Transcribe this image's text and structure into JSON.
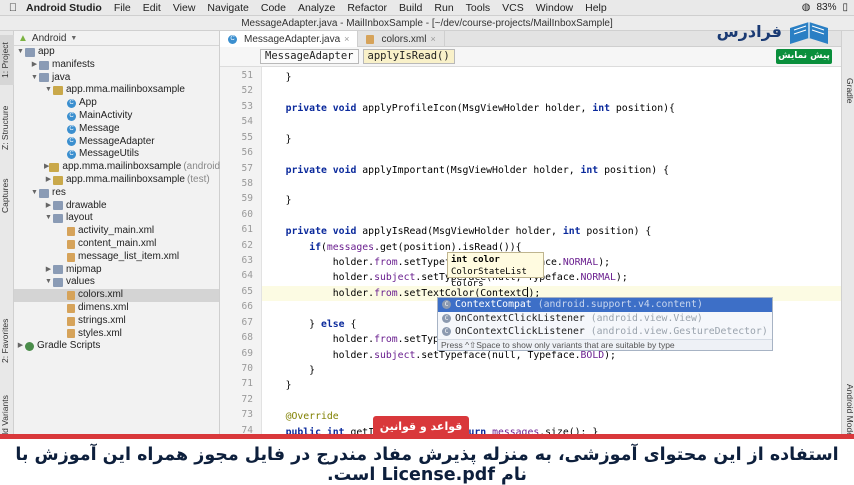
{
  "menubar": {
    "apple": "",
    "app_name": "Android Studio",
    "items": [
      "File",
      "Edit",
      "View",
      "Navigate",
      "Code",
      "Analyze",
      "Refactor",
      "Build",
      "Run",
      "Tools",
      "VCS",
      "Window",
      "Help"
    ],
    "battery": "83%"
  },
  "window": {
    "title": "MessageAdapter.java - MailInboxSample - [~/dev/course-projects/MailInboxSample]"
  },
  "left_strip": {
    "project": "1: Project",
    "structure": "Z: Structure",
    "captures": "Captures",
    "favorites": "2: Favorites",
    "build_variants": "Build Variants"
  },
  "right_strip": {
    "gradle": "Gradle",
    "android_model": "Android Model"
  },
  "project_panel": {
    "view_selector": "Android",
    "tree": [
      {
        "label": "app",
        "icon": "folder",
        "depth": 0,
        "arrow": "▼"
      },
      {
        "label": "manifests",
        "icon": "folder",
        "depth": 1,
        "arrow": "▶"
      },
      {
        "label": "java",
        "icon": "folder",
        "depth": 1,
        "arrow": "▼"
      },
      {
        "label": "app.mma.mailinboxsample",
        "icon": "package",
        "depth": 2,
        "arrow": "▼"
      },
      {
        "label": "App",
        "icon": "class",
        "depth": 3,
        "arrow": ""
      },
      {
        "label": "MainActivity",
        "icon": "class",
        "depth": 3,
        "arrow": ""
      },
      {
        "label": "Message",
        "icon": "class",
        "depth": 3,
        "arrow": ""
      },
      {
        "label": "MessageAdapter",
        "icon": "class",
        "depth": 3,
        "arrow": ""
      },
      {
        "label": "MessageUtils",
        "icon": "class",
        "depth": 3,
        "arrow": ""
      },
      {
        "label": "app.mma.mailinboxsample",
        "suffix": "(android",
        "icon": "package",
        "depth": 2,
        "arrow": "▶"
      },
      {
        "label": "app.mma.mailinboxsample",
        "suffix": "(test)",
        "icon": "package",
        "depth": 2,
        "arrow": "▶"
      },
      {
        "label": "res",
        "icon": "folder",
        "depth": 1,
        "arrow": "▼"
      },
      {
        "label": "drawable",
        "icon": "folder",
        "depth": 2,
        "arrow": "▶"
      },
      {
        "label": "layout",
        "icon": "folder",
        "depth": 2,
        "arrow": "▼"
      },
      {
        "label": "activity_main.xml",
        "icon": "xml",
        "depth": 3,
        "arrow": ""
      },
      {
        "label": "content_main.xml",
        "icon": "xml",
        "depth": 3,
        "arrow": ""
      },
      {
        "label": "message_list_item.xml",
        "icon": "xml",
        "depth": 3,
        "arrow": ""
      },
      {
        "label": "mipmap",
        "icon": "folder",
        "depth": 2,
        "arrow": "▶"
      },
      {
        "label": "values",
        "icon": "folder",
        "depth": 2,
        "arrow": "▼"
      },
      {
        "label": "colors.xml",
        "icon": "xml",
        "depth": 3,
        "arrow": "",
        "selected": true
      },
      {
        "label": "dimens.xml",
        "icon": "xml",
        "depth": 3,
        "arrow": ""
      },
      {
        "label": "strings.xml",
        "icon": "xml",
        "depth": 3,
        "arrow": ""
      },
      {
        "label": "styles.xml",
        "icon": "xml",
        "depth": 3,
        "arrow": ""
      },
      {
        "label": "Gradle Scripts",
        "icon": "gradle",
        "depth": 0,
        "arrow": "▶"
      }
    ]
  },
  "tabs": [
    {
      "label": "MessageAdapter.java",
      "active": true
    },
    {
      "label": "colors.xml",
      "active": false
    }
  ],
  "breadcrumb": [
    "MessageAdapter",
    "applyIsRead()"
  ],
  "editor": {
    "line_numbers": [
      "51",
      "52",
      "53",
      "54",
      "55",
      "56",
      "57",
      "58",
      "59",
      "60",
      "61",
      "62",
      "63",
      "64",
      "65",
      "66",
      "67",
      "68",
      "69",
      "70",
      "71",
      "72",
      "73",
      "74"
    ],
    "current_line": "65",
    "lines": [
      [
        {
          "t": "    }"
        }
      ],
      [
        {
          "t": ""
        }
      ],
      [
        {
          "t": "    "
        },
        {
          "t": "private void ",
          "c": "kw"
        },
        {
          "t": "applyProfileIcon(MsgViewHolder holder, "
        },
        {
          "t": "int ",
          "c": "kw"
        },
        {
          "t": "position){"
        }
      ],
      [
        {
          "t": ""
        }
      ],
      [
        {
          "t": "    }"
        }
      ],
      [
        {
          "t": ""
        }
      ],
      [
        {
          "t": "    "
        },
        {
          "t": "private void ",
          "c": "kw"
        },
        {
          "t": "applyImportant(MsgViewHolder holder, "
        },
        {
          "t": "int ",
          "c": "kw"
        },
        {
          "t": "position) {"
        }
      ],
      [
        {
          "t": ""
        }
      ],
      [
        {
          "t": "    }"
        }
      ],
      [
        {
          "t": ""
        }
      ],
      [
        {
          "t": "    "
        },
        {
          "t": "private void ",
          "c": "kw"
        },
        {
          "t": "applyIsRead(MsgViewHolder holder, "
        },
        {
          "t": "int ",
          "c": "kw"
        },
        {
          "t": "position) {"
        }
      ],
      [
        {
          "t": "        "
        },
        {
          "t": "if",
          "c": "kw"
        },
        {
          "t": "("
        },
        {
          "t": "messages",
          "c": "fld"
        },
        {
          "t": ".get(position).isRead()){"
        }
      ],
      [
        {
          "t": "            holder."
        },
        {
          "t": "from",
          "c": "fld"
        },
        {
          "t": ".setTypeface(null, Typeface."
        },
        {
          "t": "NORMAL",
          "c": "fld"
        },
        {
          "t": ");"
        }
      ],
      [
        {
          "t": "            holder."
        },
        {
          "t": "subject",
          "c": "fld"
        },
        {
          "t": ".setTypeface(null, Typeface."
        },
        {
          "t": "NORMAL",
          "c": "fld"
        },
        {
          "t": ");"
        }
      ],
      [
        {
          "t": "            holder."
        },
        {
          "t": "from",
          "c": "fld"
        },
        {
          "t": ".setTextColor(ContextC"
        },
        {
          "t": "",
          "c": "caret"
        },
        {
          "t": ");"
        }
      ],
      [
        {
          "t": ""
        }
      ],
      [
        {
          "t": "        } "
        },
        {
          "t": "else ",
          "c": "kw"
        },
        {
          "t": "{"
        }
      ],
      [
        {
          "t": "            holder."
        },
        {
          "t": "from",
          "c": "fld"
        },
        {
          "t": ".setTypeface(null, Typeface."
        },
        {
          "t": "BOLD",
          "c": "fld"
        },
        {
          "t": ");"
        }
      ],
      [
        {
          "t": "            holder."
        },
        {
          "t": "subject",
          "c": "fld"
        },
        {
          "t": ".setTypeface(null, Typeface."
        },
        {
          "t": "BOLD",
          "c": "fld"
        },
        {
          "t": ");"
        }
      ],
      [
        {
          "t": "        }"
        }
      ],
      [
        {
          "t": "    }"
        }
      ],
      [
        {
          "t": ""
        }
      ],
      [
        {
          "t": "    "
        },
        {
          "t": "@Override",
          "c": "ann"
        }
      ],
      [
        {
          "t": "    "
        },
        {
          "t": "public int ",
          "c": "kw"
        },
        {
          "t": "getItemCount() { "
        },
        {
          "t": "return ",
          "c": "kw"
        },
        {
          "t": "messages",
          "c": "fld"
        },
        {
          "t": ".size(); }"
        }
      ]
    ]
  },
  "param_info": [
    "int color",
    "ColorStateList colors"
  ],
  "completion": {
    "items": [
      {
        "name": "ContextCompat",
        "pkg": "(android.support.v4.content)",
        "selected": true
      },
      {
        "name": "OnContextClickListener",
        "pkg": "(android.view.View)",
        "selected": false
      },
      {
        "name": "OnContextClickListener",
        "pkg": "(android.view.GestureDetector)",
        "selected": false
      }
    ],
    "footer": "Press ^⇧Space to show only variants that are suitable by type"
  },
  "logo": {
    "name": "فرادرس",
    "preview": "پیش نمایش"
  },
  "notice": {
    "badge": "قواعد و قوانین",
    "text": "استفاده از این محتوای آموزشی، به منزله پذیرش مفاد مندرج در فایل مجوز همراه این آموزش با نام License.pdf است."
  }
}
